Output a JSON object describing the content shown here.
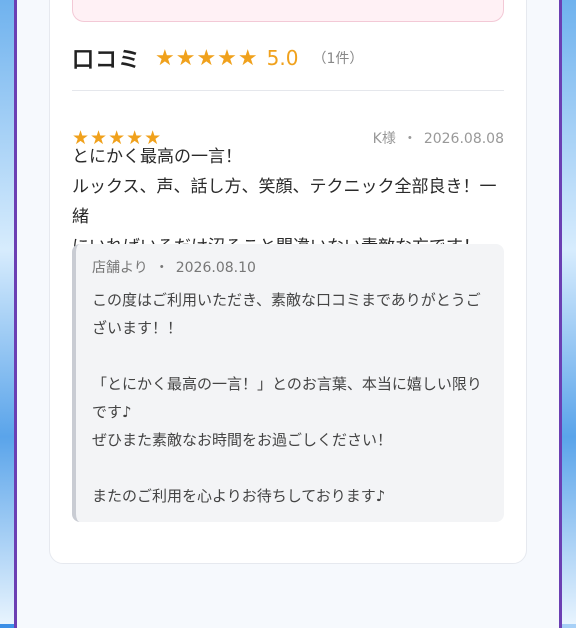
{
  "reviews_section": {
    "title": "口コミ",
    "stars": "★★★★★",
    "rating": "5.0",
    "count": "（1件）"
  },
  "review": {
    "stars": "★★★★★",
    "author": "K様",
    "separator": "・",
    "date": "2026.08.08",
    "body_lines": [
      "とにかく最高の一言！",
      "ルックス、声、話し方、笑顔、テクニック全部良き！一緒",
      "にいればいるだけ沼ること間違いない素敵な方です！"
    ]
  },
  "reply": {
    "from": "店舗より",
    "separator": "・",
    "date": "2026.08.10",
    "body": "この度はご利用いただき、素敵な口コミまでありがとうご\nざいます！！\n\n「とにかく最高の一言！」とのお言葉、本当に嬉しい限り\nです♪\nぜひまた素敵なお時間をお過ごしください！\n\nまたのご利用を心よりお待ちしております♪"
  },
  "colors": {
    "star": "#f0a11c",
    "frame_border": "#6b3fb3",
    "reply_bg": "#f3f4f6"
  }
}
